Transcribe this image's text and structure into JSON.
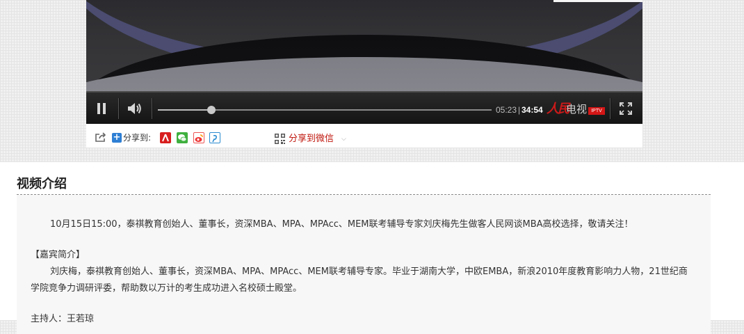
{
  "player": {
    "time_current": "05:23",
    "time_separator": "|",
    "time_total": "34:54",
    "progress": 0.16,
    "logo_text": "人民",
    "logo_text2": "电视",
    "logo_badge": "IPTV",
    "icons": [
      "pause-icon",
      "volume-icon",
      "fullscreen-icon"
    ]
  },
  "share": {
    "label": "分享到:",
    "wechat_label": "分享到微信",
    "icons": [
      "share-export-icon",
      "plus-icon",
      "people-icon",
      "wechat-icon",
      "weibo-icon",
      "qzone-icon",
      "qr-code-icon",
      "chevron-down-icon"
    ]
  },
  "intro": {
    "title": "视频介绍",
    "paragraph1": "10月15日15:00，泰祺教育创始人、董事长，资深MBA、MPA、MPAcc、MEM联考辅导专家刘庆梅先生做客人民网谈MBA高校选择，敬请关注！",
    "guest_heading": "【嘉宾简介】",
    "guest_line1": "刘庆梅，泰祺教育创始人、董事长，资深MBA、MPA、MPAcc、MEM联考辅导专家。毕业于湖南大学，中欧EMBA，新浪2010年度教育影响力人物，21世纪商",
    "guest_line2": "学院竞争力调研评委，帮助数以万计的考生成功进入名校硕士殿堂。",
    "host_line": "主持人：王若琼"
  },
  "colors": {
    "accent_underline": "#f2c300",
    "wechat_text": "#c0180f",
    "logo_red": "#cc1a1a"
  }
}
